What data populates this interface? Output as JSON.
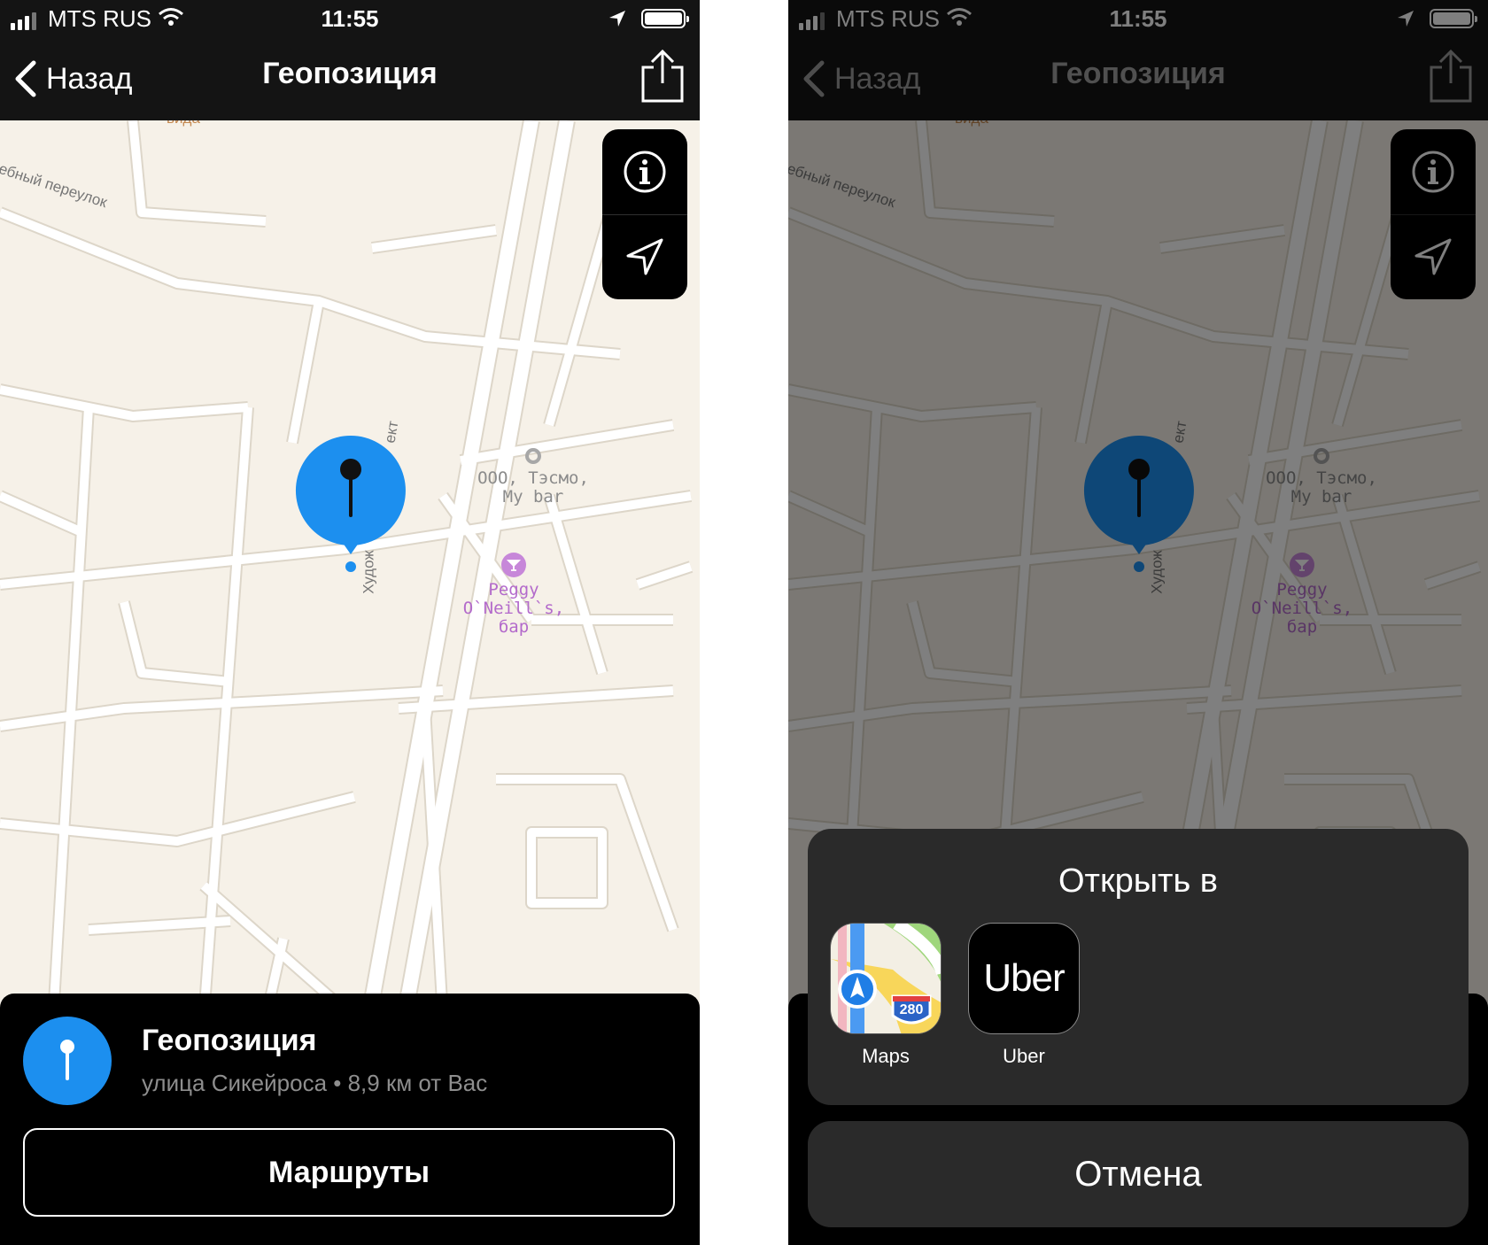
{
  "status": {
    "carrier": "MTS RUS",
    "time": "11:55"
  },
  "nav": {
    "back_label": "Назад",
    "title": "Геопозиция"
  },
  "map": {
    "street_lane": "ебный переулок",
    "street_main_top": "ект",
    "street_main_bottom": "Худож",
    "poi_1": {
      "line1": "ООО, Тэсмо,",
      "line2": "My bar"
    },
    "poi_2": {
      "line1": "Peggy",
      "line2": "O`Neill`s, бар"
    },
    "top_fragment": "вида"
  },
  "card": {
    "title": "Геопозиция",
    "subtitle": "улица Сикейроса • 8,9 км от Вас",
    "routes_button": "Маршруты"
  },
  "sheet": {
    "title": "Открыть в",
    "apps": [
      {
        "name": "Maps",
        "badge": "280"
      },
      {
        "name": "Uber",
        "logo_text": "Uber"
      }
    ],
    "cancel": "Отмена"
  },
  "colors": {
    "accent_blue": "#1c8fef",
    "map_bg": "#f6f1e8",
    "bar_bg": "#141414"
  }
}
